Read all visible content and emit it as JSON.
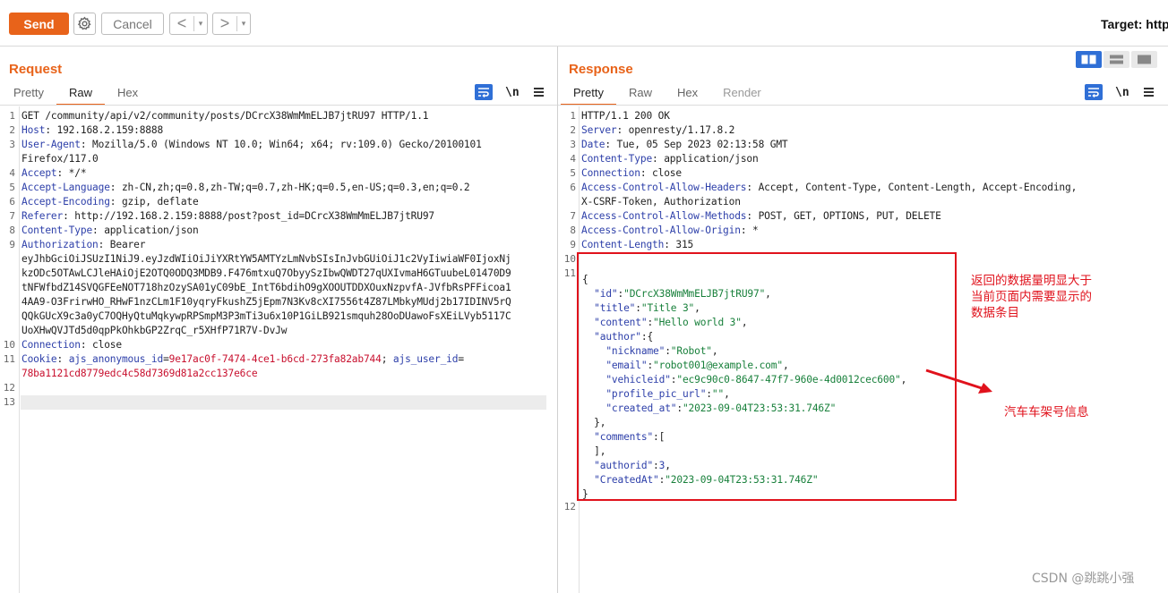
{
  "toolbar": {
    "send_label": "Send",
    "cancel_label": "Cancel",
    "back_arrow": "<",
    "forward_arrow": ">",
    "dropdown_glyph": "▾",
    "target_label": "Target: http"
  },
  "request": {
    "title": "Request",
    "tabs": [
      "Pretty",
      "Raw",
      "Hex"
    ],
    "active_tab": "Raw",
    "newline_toggle": "\\n",
    "lines": [
      {
        "n": "1",
        "parts": [
          {
            "t": "GET /community/api/v2/community/posts/DCrcX38WmMmELJB7jtRU97 HTTP/1.1",
            "c": "v"
          }
        ]
      },
      {
        "n": "2",
        "parts": [
          {
            "t": "Host",
            "c": "k"
          },
          {
            "t": ": 192.168.2.159:8888",
            "c": "v"
          }
        ]
      },
      {
        "n": "3",
        "parts": [
          {
            "t": "User-Agent",
            "c": "k"
          },
          {
            "t": ": Mozilla/5.0 (Windows NT 10.0; Win64; x64; rv:109.0) Gecko/20100101",
            "c": "v"
          }
        ]
      },
      {
        "n": "",
        "parts": [
          {
            "t": "Firefox/117.0",
            "c": "v"
          }
        ]
      },
      {
        "n": "4",
        "parts": [
          {
            "t": "Accept",
            "c": "k"
          },
          {
            "t": ": */*",
            "c": "v"
          }
        ]
      },
      {
        "n": "5",
        "parts": [
          {
            "t": "Accept-Language",
            "c": "k"
          },
          {
            "t": ": zh-CN,zh;q=0.8,zh-TW;q=0.7,zh-HK;q=0.5,en-US;q=0.3,en;q=0.2",
            "c": "v"
          }
        ]
      },
      {
        "n": "6",
        "parts": [
          {
            "t": "Accept-Encoding",
            "c": "k"
          },
          {
            "t": ": gzip, deflate",
            "c": "v"
          }
        ]
      },
      {
        "n": "7",
        "parts": [
          {
            "t": "Referer",
            "c": "k"
          },
          {
            "t": ": http://192.168.2.159:8888/post?post_id=DCrcX38WmMmELJB7jtRU97",
            "c": "v"
          }
        ]
      },
      {
        "n": "8",
        "parts": [
          {
            "t": "Content-Type",
            "c": "k"
          },
          {
            "t": ": application/json",
            "c": "v"
          }
        ]
      },
      {
        "n": "9",
        "parts": [
          {
            "t": "Authorization",
            "c": "k"
          },
          {
            "t": ": Bearer",
            "c": "v"
          }
        ]
      },
      {
        "n": "",
        "parts": [
          {
            "t": "eyJhbGciOiJSUzI1NiJ9.eyJzdWIiOiJiYXRtYW5AMTYzLmNvbSIsInJvbGUiOiJ1c2VyIiwiaWF0IjoxNj",
            "c": "v"
          }
        ]
      },
      {
        "n": "",
        "parts": [
          {
            "t": "kzODc5OTAwLCJleHAiOjE2OTQ0ODQ3MDB9.F476mtxuQ7ObyySzIbwQWDT27qUXIvmaH6GTuubeL01470D9",
            "c": "v"
          }
        ]
      },
      {
        "n": "",
        "parts": [
          {
            "t": "tNFWfbdZ14SVQGFEeNOT718hzOzySA01yC09bE_IntT6bdihO9gXOOUTDDXOuxNzpvfA-JVfbRsPFFicoa1",
            "c": "v"
          }
        ]
      },
      {
        "n": "",
        "parts": [
          {
            "t": "4AA9-O3FrirwHO_RHwF1nzCLm1F10yqryFkushZ5jEpm7N3Kv8cXI7556t4Z87LMbkyMUdj2b17IDINV5rQ",
            "c": "v"
          }
        ]
      },
      {
        "n": "",
        "parts": [
          {
            "t": "QQkGUcX9c3a0yC7OQHyQtuMqkywpRPSmpM3P3mTi3u6x10P1GiLB921smquh28OoDUawoFsXEiLVyb5117C",
            "c": "v"
          }
        ]
      },
      {
        "n": "",
        "parts": [
          {
            "t": "UoXHwQVJTd5d0qpPkOhkbGP2ZrqC_r5XHfP71R7V-DvJw",
            "c": "v"
          }
        ]
      },
      {
        "n": "10",
        "parts": [
          {
            "t": "Connection",
            "c": "k"
          },
          {
            "t": ": close",
            "c": "v"
          }
        ]
      },
      {
        "n": "11",
        "parts": [
          {
            "t": "Cookie",
            "c": "k"
          },
          {
            "t": ": ",
            "c": "v"
          },
          {
            "t": "ajs_anonymous_id",
            "c": "k"
          },
          {
            "t": "=",
            "c": "v"
          },
          {
            "t": "9e17ac0f-7474-4ce1-b6cd-273fa82ab744",
            "c": "kred"
          },
          {
            "t": "; ",
            "c": "v"
          },
          {
            "t": "ajs_user_id",
            "c": "k"
          },
          {
            "t": "=",
            "c": "v"
          }
        ]
      },
      {
        "n": "",
        "parts": [
          {
            "t": "78ba1121cd8779edc4c58d7369d81a2cc137e6ce",
            "c": "kred"
          }
        ]
      },
      {
        "n": "12",
        "parts": []
      },
      {
        "n": "13",
        "parts": []
      }
    ]
  },
  "response": {
    "title": "Response",
    "tabs": [
      "Pretty",
      "Raw",
      "Hex",
      "Render"
    ],
    "active_tab": "Pretty",
    "newline_toggle": "\\n",
    "lines": [
      {
        "n": "1",
        "parts": [
          {
            "t": "HTTP/1.1 200 OK",
            "c": "v"
          }
        ]
      },
      {
        "n": "2",
        "parts": [
          {
            "t": "Server",
            "c": "k"
          },
          {
            "t": ": openresty/1.17.8.2",
            "c": "v"
          }
        ]
      },
      {
        "n": "3",
        "parts": [
          {
            "t": "Date",
            "c": "k"
          },
          {
            "t": ": Tue, 05 Sep 2023 02:13:58 GMT",
            "c": "v"
          }
        ]
      },
      {
        "n": "4",
        "parts": [
          {
            "t": "Content-Type",
            "c": "k"
          },
          {
            "t": ": application/json",
            "c": "v"
          }
        ]
      },
      {
        "n": "5",
        "parts": [
          {
            "t": "Connection",
            "c": "k"
          },
          {
            "t": ": close",
            "c": "v"
          }
        ]
      },
      {
        "n": "6",
        "parts": [
          {
            "t": "Access-Control-Allow-Headers",
            "c": "k"
          },
          {
            "t": ": Accept, Content-Type, Content-Length, Accept-Encoding,",
            "c": "v"
          }
        ]
      },
      {
        "n": "",
        "parts": [
          {
            "t": "X-CSRF-Token, Authorization",
            "c": "v"
          }
        ]
      },
      {
        "n": "7",
        "parts": [
          {
            "t": "Access-Control-Allow-Methods",
            "c": "k"
          },
          {
            "t": ": POST, GET, OPTIONS, PUT, DELETE",
            "c": "v"
          }
        ]
      },
      {
        "n": "8",
        "parts": [
          {
            "t": "Access-Control-Allow-Origin",
            "c": "k"
          },
          {
            "t": ": *",
            "c": "v"
          }
        ]
      },
      {
        "n": "9",
        "parts": [
          {
            "t": "Content-Length",
            "c": "k"
          },
          {
            "t": ": 315",
            "c": "v"
          }
        ]
      },
      {
        "n": "10",
        "parts": []
      },
      {
        "n": "11",
        "parts": [
          {
            "t": "{",
            "c": "v"
          }
        ]
      },
      {
        "n": "",
        "parts": [
          {
            "t": "  ",
            "c": "v"
          },
          {
            "t": "\"id\"",
            "c": "jkey"
          },
          {
            "t": ":",
            "c": "v"
          },
          {
            "t": "\"DCrcX38WmMmELJB7jtRU97\"",
            "c": "jstr"
          },
          {
            "t": ",",
            "c": "v"
          }
        ]
      },
      {
        "n": "",
        "parts": [
          {
            "t": "  ",
            "c": "v"
          },
          {
            "t": "\"title\"",
            "c": "jkey"
          },
          {
            "t": ":",
            "c": "v"
          },
          {
            "t": "\"Title 3\"",
            "c": "jstr"
          },
          {
            "t": ",",
            "c": "v"
          }
        ]
      },
      {
        "n": "",
        "parts": [
          {
            "t": "  ",
            "c": "v"
          },
          {
            "t": "\"content\"",
            "c": "jkey"
          },
          {
            "t": ":",
            "c": "v"
          },
          {
            "t": "\"Hello world 3\"",
            "c": "jstr"
          },
          {
            "t": ",",
            "c": "v"
          }
        ]
      },
      {
        "n": "",
        "parts": [
          {
            "t": "  ",
            "c": "v"
          },
          {
            "t": "\"author\"",
            "c": "jkey"
          },
          {
            "t": ":{",
            "c": "v"
          }
        ]
      },
      {
        "n": "",
        "parts": [
          {
            "t": "    ",
            "c": "v"
          },
          {
            "t": "\"nickname\"",
            "c": "jkey"
          },
          {
            "t": ":",
            "c": "v"
          },
          {
            "t": "\"Robot\"",
            "c": "jstr"
          },
          {
            "t": ",",
            "c": "v"
          }
        ]
      },
      {
        "n": "",
        "parts": [
          {
            "t": "    ",
            "c": "v"
          },
          {
            "t": "\"email\"",
            "c": "jkey"
          },
          {
            "t": ":",
            "c": "v"
          },
          {
            "t": "\"robot001@example.com\"",
            "c": "jstr"
          },
          {
            "t": ",",
            "c": "v"
          }
        ]
      },
      {
        "n": "",
        "parts": [
          {
            "t": "    ",
            "c": "v"
          },
          {
            "t": "\"vehicleid\"",
            "c": "jkey"
          },
          {
            "t": ":",
            "c": "v"
          },
          {
            "t": "\"ec9c90c0-8647-47f7-960e-4d0012cec600\"",
            "c": "jstr"
          },
          {
            "t": ",",
            "c": "v"
          }
        ]
      },
      {
        "n": "",
        "parts": [
          {
            "t": "    ",
            "c": "v"
          },
          {
            "t": "\"profile_pic_url\"",
            "c": "jkey"
          },
          {
            "t": ":",
            "c": "v"
          },
          {
            "t": "\"\"",
            "c": "jstr"
          },
          {
            "t": ",",
            "c": "v"
          }
        ]
      },
      {
        "n": "",
        "parts": [
          {
            "t": "    ",
            "c": "v"
          },
          {
            "t": "\"created_at\"",
            "c": "jkey"
          },
          {
            "t": ":",
            "c": "v"
          },
          {
            "t": "\"2023-09-04T23:53:31.746Z\"",
            "c": "jstr"
          }
        ]
      },
      {
        "n": "",
        "parts": [
          {
            "t": "  },",
            "c": "v"
          }
        ]
      },
      {
        "n": "",
        "parts": [
          {
            "t": "  ",
            "c": "v"
          },
          {
            "t": "\"comments\"",
            "c": "jkey"
          },
          {
            "t": ":[",
            "c": "v"
          }
        ]
      },
      {
        "n": "",
        "parts": [
          {
            "t": "  ],",
            "c": "v"
          }
        ]
      },
      {
        "n": "",
        "parts": [
          {
            "t": "  ",
            "c": "v"
          },
          {
            "t": "\"authorid\"",
            "c": "jkey"
          },
          {
            "t": ":",
            "c": "v"
          },
          {
            "t": "3",
            "c": "k"
          },
          {
            "t": ",",
            "c": "v"
          }
        ]
      },
      {
        "n": "",
        "parts": [
          {
            "t": "  ",
            "c": "v"
          },
          {
            "t": "\"CreatedAt\"",
            "c": "jkey"
          },
          {
            "t": ":",
            "c": "v"
          },
          {
            "t": "\"2023-09-04T23:53:31.746Z\"",
            "c": "jstr"
          }
        ]
      },
      {
        "n": "",
        "parts": [
          {
            "t": "}",
            "c": "v"
          }
        ]
      },
      {
        "n": "12",
        "parts": []
      }
    ]
  },
  "annotations": {
    "box_note_lines": [
      "返回的数据量明显大于",
      "当前页面内需要显示的",
      "数据条目"
    ],
    "arrow_note": "汽车车架号信息",
    "color": "#e0121c"
  },
  "watermark": "CSDN @跳跳小强",
  "colors": {
    "accent": "#e8631a",
    "header_key": "#2d3fa9",
    "json_string": "#18803b",
    "cookie_value": "#c8102e",
    "toggle_blue": "#2f6fd6"
  }
}
